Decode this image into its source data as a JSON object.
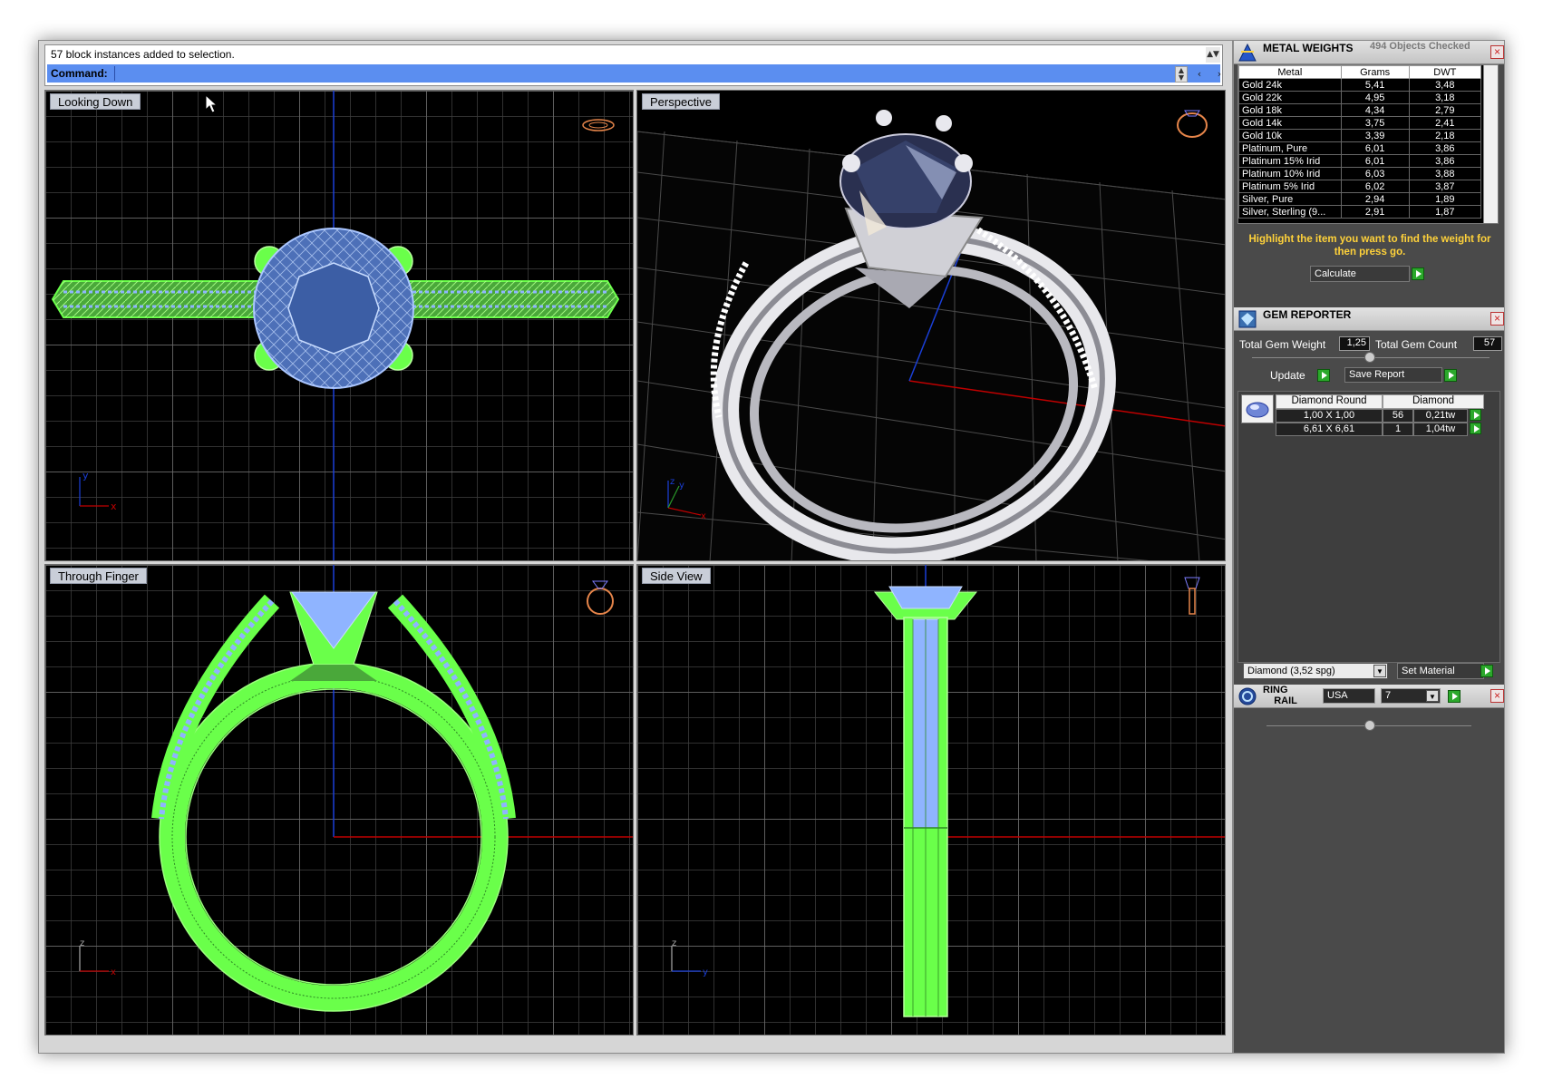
{
  "command": {
    "history": "57 block instances added to selection.",
    "prompt": "Command:",
    "value": ""
  },
  "viewports": {
    "top_left": "Looking Down",
    "top_right": "Perspective",
    "bottom_left": "Through Finger",
    "bottom_right": "Side View"
  },
  "metal_weights": {
    "title": "METAL WEIGHTS",
    "objects_checked": "494 Objects Checked",
    "columns": [
      "Metal",
      "Grams",
      "DWT"
    ],
    "rows": [
      [
        "Gold 24k",
        "5,41",
        "3,48"
      ],
      [
        "Gold 22k",
        "4,95",
        "3,18"
      ],
      [
        "Gold 18k",
        "4,34",
        "2,79"
      ],
      [
        "Gold 14k",
        "3,75",
        "2,41"
      ],
      [
        "Gold 10k",
        "3,39",
        "2,18"
      ],
      [
        "Platinum, Pure",
        "6,01",
        "3,86"
      ],
      [
        "Platinum 15% Irid",
        "6,01",
        "3,86"
      ],
      [
        "Platinum 10% Irid",
        "6,03",
        "3,88"
      ],
      [
        "Platinum 5% Irid",
        "6,02",
        "3,87"
      ],
      [
        "Silver, Pure",
        "2,94",
        "1,89"
      ],
      [
        "Silver, Sterling (9...",
        "2,91",
        "1,87"
      ]
    ],
    "hint": "Highlight the item you want to find the weight for then press go.",
    "calculate_label": "Calculate"
  },
  "gem_reporter": {
    "title": "GEM REPORTER",
    "total_weight_label": "Total Gem Weight",
    "total_weight": "1,25",
    "total_count_label": "Total Gem Count",
    "total_count": "57",
    "update_label": "Update",
    "save_label": "Save Report",
    "col_shape": "Diamond Round",
    "col_type": "Diamond",
    "rows": [
      [
        "1,00 X 1,00",
        "56",
        "0,21tw"
      ],
      [
        "6,61 X 6,61",
        "1",
        "1,04tw"
      ]
    ],
    "material_select": "Diamond    (3,52 spg)",
    "set_material_label": "Set Material"
  },
  "ring_rail": {
    "title_line1": "RING",
    "title_line2": "RAIL",
    "country": "USA",
    "size": "7"
  },
  "axis": {
    "x": "x",
    "y": "y",
    "z": "z"
  },
  "colors": {
    "command_bar": "#5b8ef0",
    "wire_green": "#6aff4a",
    "gem_blue": "#8fb4ff",
    "hint_text": "#ffd23a",
    "axis_red": "#c00000",
    "axis_blue": "#1a3fd8"
  }
}
